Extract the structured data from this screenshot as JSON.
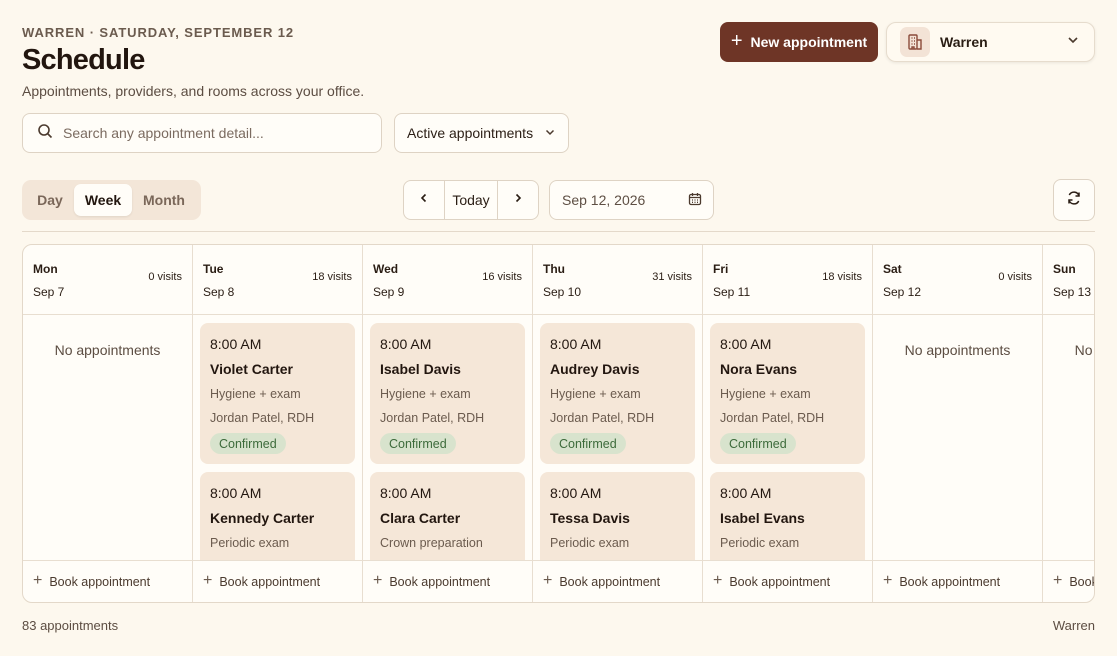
{
  "header": {
    "eyebrow": "WARREN · SATURDAY, SEPTEMBER 12",
    "title": "Schedule",
    "subtitle": "Appointments, providers, and rooms across your office."
  },
  "actions": {
    "new_label": "New appointment",
    "office_name": "Warren"
  },
  "search": {
    "placeholder": "Search any appointment detail..."
  },
  "filter": {
    "selected": "Active appointments"
  },
  "view": {
    "options": [
      "Day",
      "Week",
      "Month"
    ],
    "active": "Week"
  },
  "nav": {
    "today_label": "Today",
    "date_value": "Sep 12, 2026"
  },
  "days": [
    {
      "name": "Mon",
      "date": "Sep 7",
      "visits": "0 visits",
      "empty": "No appointments",
      "book": "Book appointment",
      "appointments": []
    },
    {
      "name": "Tue",
      "date": "Sep 8",
      "visits": "18 visits",
      "empty": "",
      "book": "Book appointment",
      "appointments": [
        {
          "time": "8:00 AM",
          "patient": "Violet Carter",
          "service": "Hygiene + exam",
          "provider": "Jordan Patel, RDH",
          "status": "Confirmed"
        },
        {
          "time": "8:00 AM",
          "patient": "Kennedy Carter",
          "service": "Periodic exam",
          "provider": "",
          "status": ""
        }
      ]
    },
    {
      "name": "Wed",
      "date": "Sep 9",
      "visits": "16 visits",
      "empty": "",
      "book": "Book appointment",
      "appointments": [
        {
          "time": "8:00 AM",
          "patient": "Isabel Davis",
          "service": "Hygiene + exam",
          "provider": "Jordan Patel, RDH",
          "status": "Confirmed"
        },
        {
          "time": "8:00 AM",
          "patient": "Clara Carter",
          "service": "Crown preparation",
          "provider": "",
          "status": ""
        }
      ]
    },
    {
      "name": "Thu",
      "date": "Sep 10",
      "visits": "31 visits",
      "empty": "",
      "book": "Book appointment",
      "appointments": [
        {
          "time": "8:00 AM",
          "patient": "Audrey Davis",
          "service": "Hygiene + exam",
          "provider": "Jordan Patel, RDH",
          "status": "Confirmed"
        },
        {
          "time": "8:00 AM",
          "patient": "Tessa Davis",
          "service": "Periodic exam",
          "provider": "",
          "status": ""
        }
      ]
    },
    {
      "name": "Fri",
      "date": "Sep 11",
      "visits": "18 visits",
      "empty": "",
      "book": "Book appointment",
      "appointments": [
        {
          "time": "8:00 AM",
          "patient": "Nora Evans",
          "service": "Hygiene + exam",
          "provider": "Jordan Patel, RDH",
          "status": "Confirmed"
        },
        {
          "time": "8:00 AM",
          "patient": "Isabel Evans",
          "service": "Periodic exam",
          "provider": "",
          "status": ""
        }
      ]
    },
    {
      "name": "Sat",
      "date": "Sep 12",
      "visits": "0 visits",
      "empty": "No appointments",
      "book": "Book appointment",
      "appointments": []
    },
    {
      "name": "Sun",
      "date": "Sep 13",
      "visits": "",
      "empty": "No appointments",
      "book": "Book appointment",
      "appointments": []
    }
  ],
  "footer": {
    "count": "83 appointments",
    "office": "Warren"
  },
  "colors": {
    "accent": "#6e3526",
    "background": "#fdf8ee",
    "card": "#f5e7d8",
    "status_bg": "#d8e3cd",
    "status_text": "#3d6b3b"
  },
  "icons": {
    "search": "search-icon",
    "chevron": "chevron-down-icon",
    "building": "building-icon",
    "calendar": "calendar-icon",
    "refresh": "refresh-icon",
    "plus": "plus-icon"
  }
}
